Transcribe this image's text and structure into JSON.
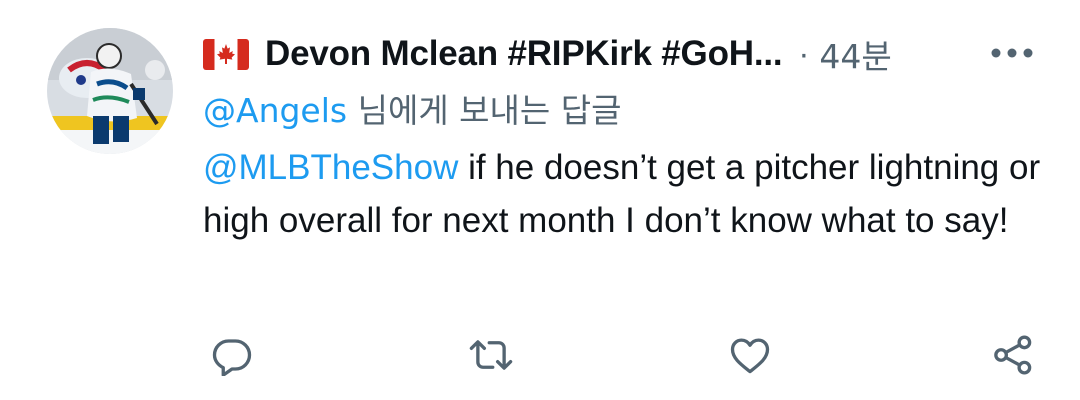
{
  "tweet": {
    "author": {
      "flag_icon": "canada-flag-icon",
      "display_name": "Devon Mclean #RIPKirk #GoH...",
      "avatar": "hockey-player-avatar"
    },
    "separator": "·",
    "timestamp": "44분",
    "reply_to": {
      "handle": "@Angels",
      "suffix": " 님에게 보내는 답글"
    },
    "body": {
      "mention": "@MLBTheShow",
      "text": " if he doesn’t get a pitcher lightning or high overall for next month I don’t know what to say!"
    },
    "actions": [
      "reply-icon",
      "retweet-icon",
      "like-icon",
      "share-icon"
    ],
    "colors": {
      "link": "#1d9bf0",
      "secondary_text": "#536471",
      "primary_text": "#0f1419",
      "flag_red": "#d52b1e"
    }
  }
}
